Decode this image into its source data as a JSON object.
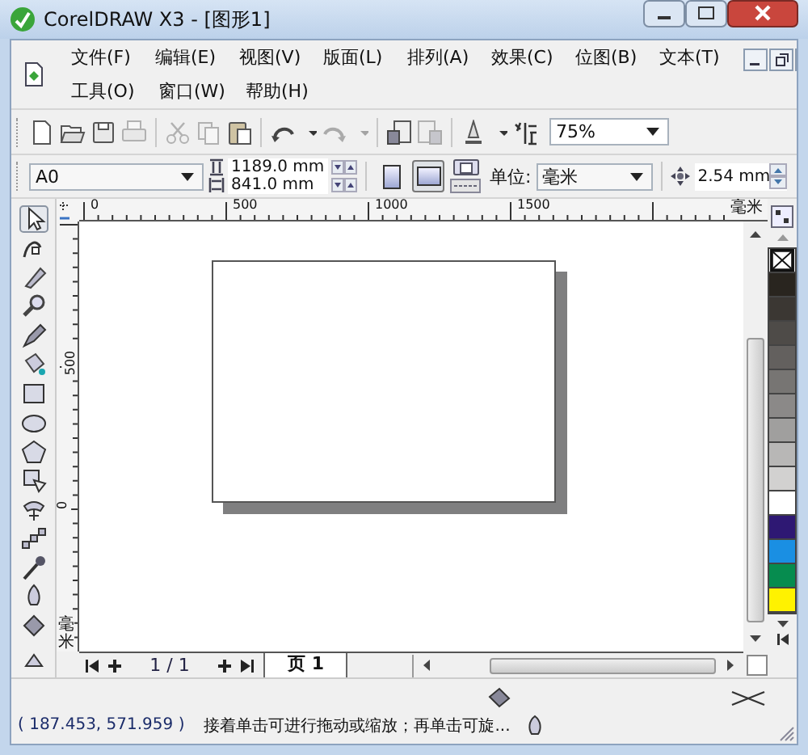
{
  "window": {
    "title": "CorelDRAW X3 - [图形1]"
  },
  "menu_lines": [
    [
      "文件(F)",
      "编辑(E)",
      "视图(V)",
      "版面(L)",
      "排列(A)",
      "效果(C)",
      "位图(B)",
      "文本(T)"
    ],
    [
      "工具(O)",
      "窗口(W)",
      "帮助(H)"
    ]
  ],
  "toolbar": [
    {
      "kind": "new",
      "disabled": false
    },
    {
      "kind": "open",
      "disabled": false
    },
    {
      "kind": "save",
      "disabled": false
    },
    {
      "kind": "print",
      "disabled": true
    },
    {
      "kind": "sep"
    },
    {
      "kind": "cut",
      "disabled": true
    },
    {
      "kind": "copy",
      "disabled": true
    },
    {
      "kind": "paste",
      "disabled": false
    },
    {
      "kind": "sep"
    },
    {
      "kind": "undo",
      "disabled": false
    },
    {
      "kind": "caret",
      "disabled": false
    },
    {
      "kind": "redo",
      "disabled": true
    },
    {
      "kind": "caret",
      "disabled": true
    },
    {
      "kind": "sep"
    },
    {
      "kind": "import",
      "disabled": false
    },
    {
      "kind": "export",
      "disabled": true
    },
    {
      "kind": "sep"
    },
    {
      "kind": "launcher",
      "disabled": false
    },
    {
      "kind": "caret",
      "disabled": false
    },
    {
      "kind": "welcome",
      "disabled": false
    }
  ],
  "zoom": {
    "value": "75%"
  },
  "property_bar": {
    "paper": "A0",
    "width": "1189.0 mm",
    "height": "841.0 mm",
    "orientation": [
      {
        "kind": "portrait",
        "selected": false
      },
      {
        "kind": "landscape",
        "selected": true
      }
    ],
    "units_label": "单位:",
    "units": "毫米",
    "nudge": "2.54 mm"
  },
  "rulers": {
    "horizontal": [
      "0",
      "500",
      "1000",
      "1500"
    ],
    "horizontal_unit": "毫米",
    "vertical": [
      "500",
      "0"
    ],
    "vertical_unit": "毫米"
  },
  "toolbox": [
    {
      "kind": "pick",
      "selected": true
    },
    {
      "kind": "shape",
      "selected": false
    },
    {
      "kind": "knife",
      "selected": false
    },
    {
      "kind": "zoom",
      "selected": false
    },
    {
      "kind": "freehand",
      "selected": false
    },
    {
      "kind": "smartfill",
      "selected": false
    },
    {
      "kind": "rectangle",
      "selected": false
    },
    {
      "kind": "ellipse",
      "selected": false
    },
    {
      "kind": "polygon",
      "selected": false
    },
    {
      "kind": "shapes",
      "selected": false
    },
    {
      "kind": "text",
      "selected": false
    },
    {
      "kind": "blend",
      "selected": false
    },
    {
      "kind": "eyedropper",
      "selected": false
    },
    {
      "kind": "outline",
      "selected": false
    },
    {
      "kind": "fill",
      "selected": false
    },
    {
      "kind": "interactive",
      "selected": false
    }
  ],
  "page_nav": {
    "count": "1 / 1",
    "tabs": [
      {
        "label": "页 1",
        "selected": true
      }
    ]
  },
  "palette": [
    {
      "kind": "none"
    },
    {
      "kind": "swatch",
      "color": "#29251f"
    },
    {
      "kind": "swatch",
      "color": "#3b3733"
    },
    {
      "kind": "swatch",
      "color": "#4e4b48"
    },
    {
      "kind": "swatch",
      "color": "#63605e"
    },
    {
      "kind": "swatch",
      "color": "#777573"
    },
    {
      "kind": "swatch",
      "color": "#8b8988"
    },
    {
      "kind": "swatch",
      "color": "#a09f9e"
    },
    {
      "kind": "swatch",
      "color": "#b8b7b6"
    },
    {
      "kind": "swatch",
      "color": "#d2d1d0"
    },
    {
      "kind": "swatch",
      "color": "#ffffff"
    },
    {
      "kind": "swatch",
      "color": "#2e1873"
    },
    {
      "kind": "swatch",
      "color": "#1a8fe3"
    },
    {
      "kind": "swatch",
      "color": "#068c4f"
    },
    {
      "kind": "swatch",
      "color": "#fff200"
    }
  ],
  "status_bar": {
    "coords": "( 187.453, 571.959 )",
    "message": "接着单击可进行拖动或缩放；再单击可旋..."
  }
}
